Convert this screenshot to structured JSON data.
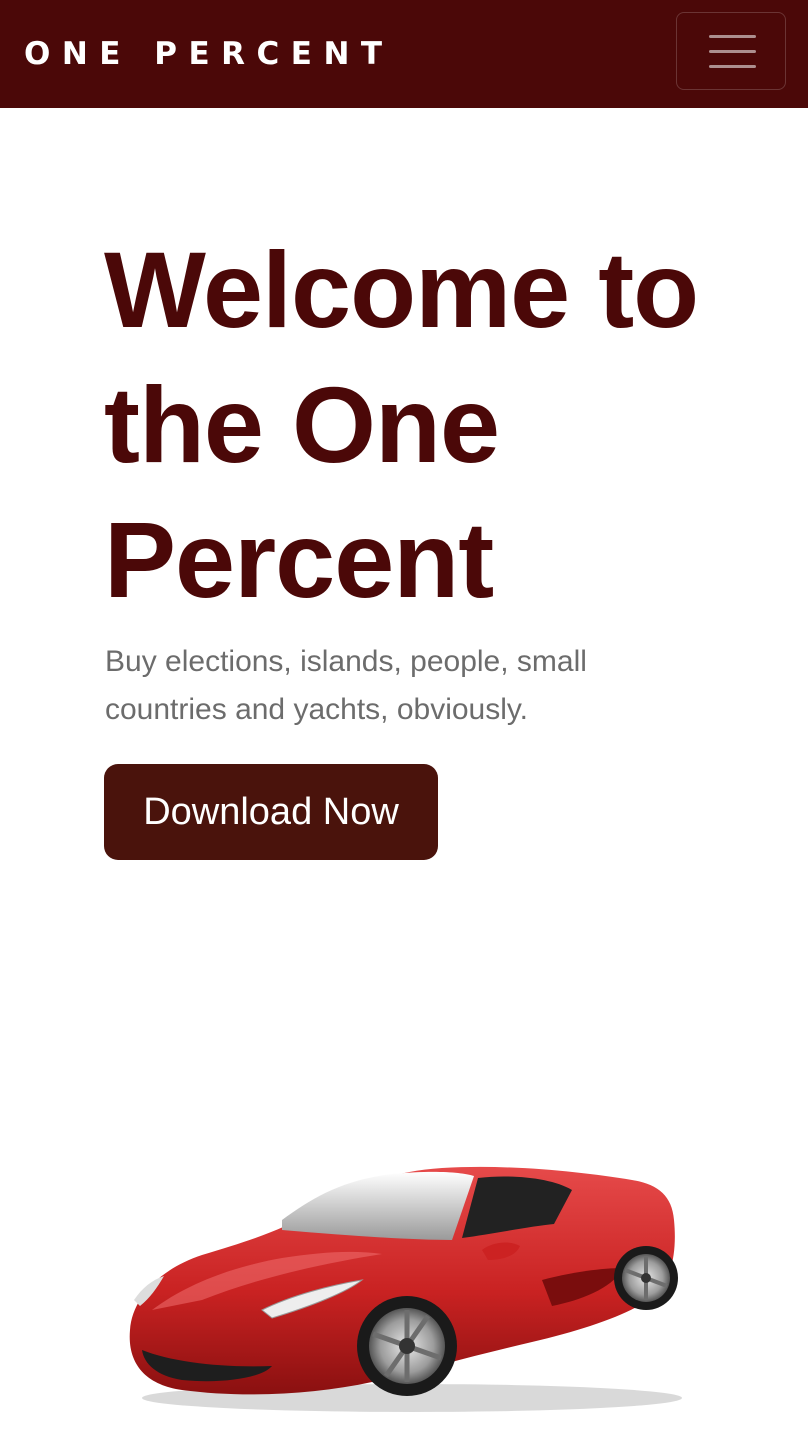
{
  "navbar": {
    "brand": "ONE PERCENT",
    "menu_icon": "hamburger-menu-icon",
    "background": "#4b0808"
  },
  "hero": {
    "title": "Welcome to the One Percent",
    "subtitle": "Buy elections, islands, people, small countries and yachts, obviously.",
    "cta_label": "Download Now",
    "title_color": "#4b0808",
    "cta_color": "#4a130c",
    "image": "red-sports-car"
  }
}
